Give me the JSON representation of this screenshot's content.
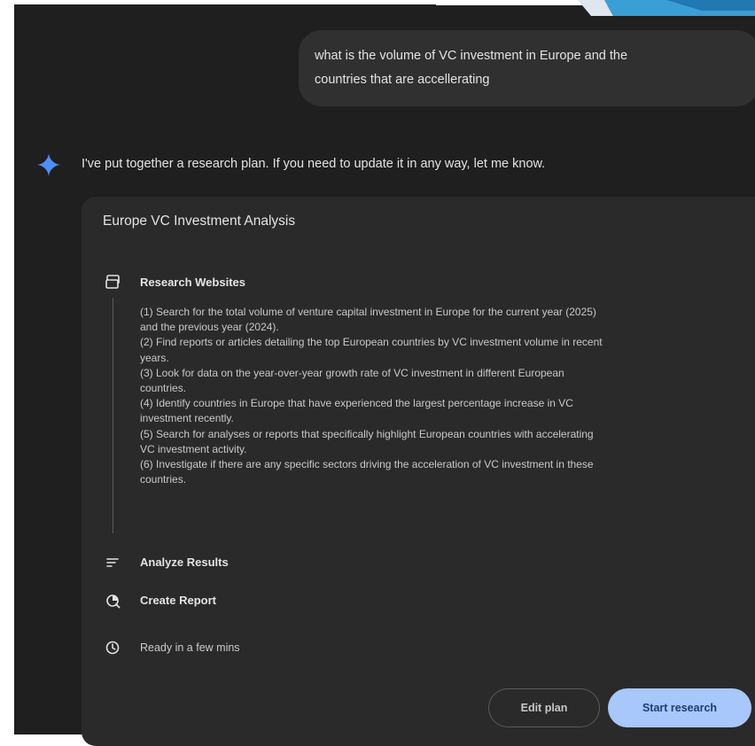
{
  "user_message": {
    "line1": "what is the volume of VC investment in Europe and the",
    "line2": "countries that are accellerating"
  },
  "assistant": {
    "intro": "I've put together a research plan. If you need to update it in any way, let me know."
  },
  "plan": {
    "title": "Europe VC Investment Analysis",
    "steps": [
      {
        "label": "Research Websites",
        "icon": "research-websites-icon"
      },
      {
        "label": "Analyze Results",
        "icon": "analyze-results-icon"
      },
      {
        "label": "Create Report",
        "icon": "create-report-icon"
      }
    ],
    "research_lines": [
      "(1) Search for the total volume of venture capital investment in Europe for the current year (2025)",
      "and the previous year (2024).",
      "(2) Find reports or articles detailing the top European countries by VC investment volume in recent",
      "years.",
      "(3) Look for data on the year-over-year growth rate of VC investment in different European",
      "countries.",
      "(4) Identify countries in Europe that have experienced the largest percentage increase in VC",
      "investment recently.",
      "(5) Search for analyses or reports that specifically highlight European countries with accelerating",
      "VC investment activity.",
      "(6) Investigate if there are any specific sectors driving the acceleration of VC investment in these",
      "countries."
    ],
    "ready_text": "Ready in a few mins"
  },
  "buttons": {
    "edit_plan": "Edit plan",
    "start_research": "Start research"
  },
  "colors": {
    "background": "#1f1f1f",
    "card": "#2a2a2a",
    "bubble": "#303030",
    "accent_blue": "#a8c7fa",
    "gem_blue": "#4f8df7"
  }
}
